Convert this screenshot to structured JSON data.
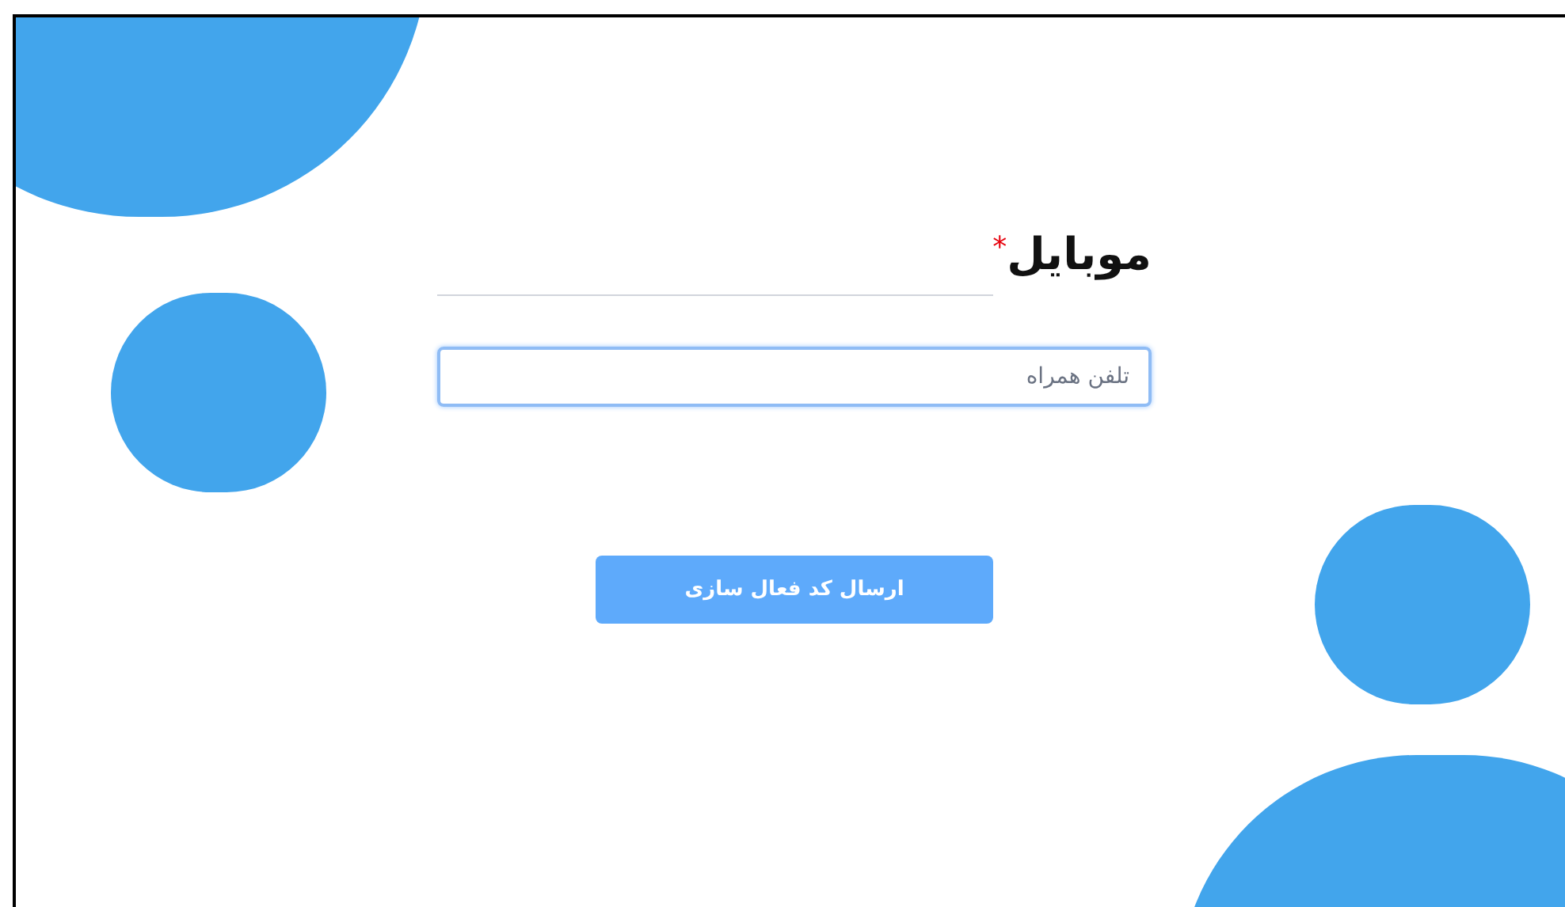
{
  "field": {
    "label": "موبایل",
    "required_mark": "*",
    "placeholder": "تلفن همراه"
  },
  "button": {
    "label": "ارسال کد فعال سازی"
  }
}
